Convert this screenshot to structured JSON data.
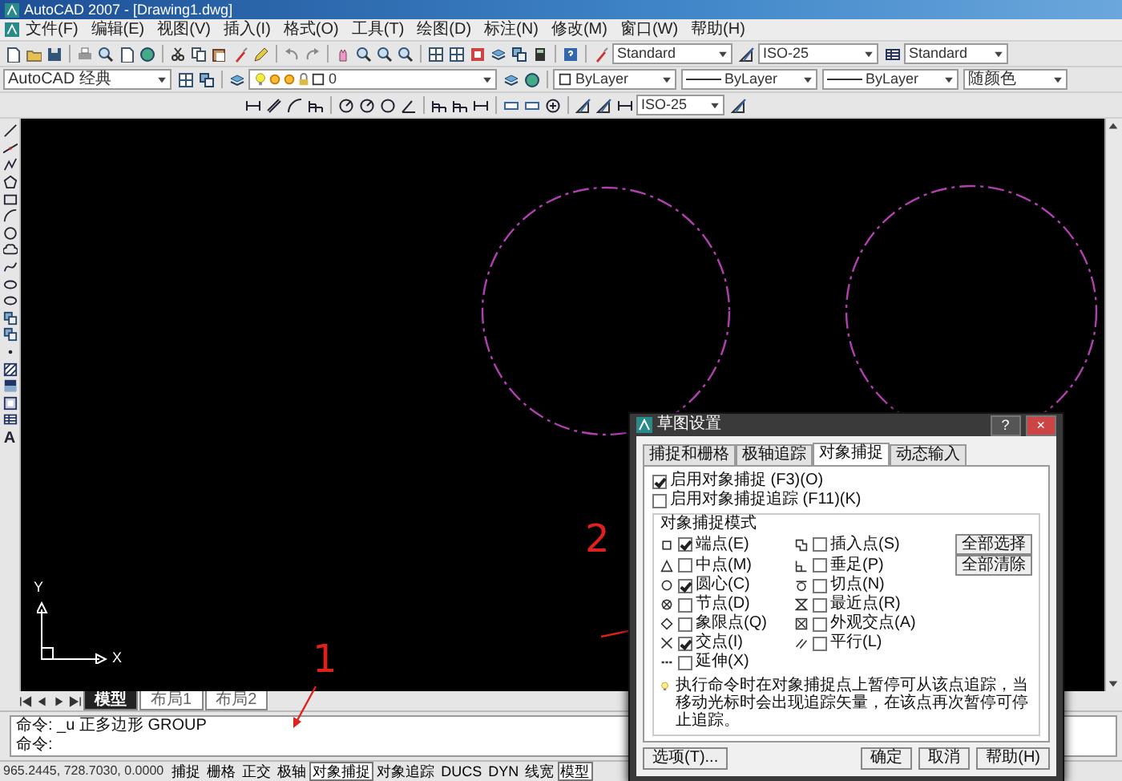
{
  "window": {
    "title": "AutoCAD 2007 - [Drawing1.dwg]"
  },
  "menu": [
    "文件(F)",
    "编辑(E)",
    "视图(V)",
    "插入(I)",
    "格式(O)",
    "工具(T)",
    "绘图(D)",
    "标注(N)",
    "修改(M)",
    "窗口(W)",
    "帮助(H)"
  ],
  "toolbar_1": {
    "text_style": "Standard",
    "dim_style": "ISO-25",
    "table_style": "Standard"
  },
  "toolbar_2": {
    "workspace": "AutoCAD 经典",
    "layer": "0",
    "color_control": "ByLayer",
    "linetype": "ByLayer",
    "lineweight": "ByLayer",
    "plot_style": "随颜色"
  },
  "toolbar_3": {
    "dim_style": "ISO-25"
  },
  "draw_toolbar": {
    "text_tool": "A"
  },
  "canvas": {
    "ucs": {
      "x_label": "X",
      "y_label": "Y"
    },
    "annotations": [
      "2",
      "1"
    ]
  },
  "layout_tabs": [
    {
      "label": "模型",
      "selected": true
    },
    {
      "label": "布局1",
      "selected": false
    },
    {
      "label": "布局2",
      "selected": false
    }
  ],
  "command_lines": [
    "命令: _u 正多边形 GROUP",
    "命令:"
  ],
  "status_bar": {
    "coordinates": "965.2445, 728.7030, 0.0000",
    "toggles": [
      {
        "label": "捕捉",
        "on": false
      },
      {
        "label": "栅格",
        "on": false
      },
      {
        "label": "正交",
        "on": false
      },
      {
        "label": "极轴",
        "on": false
      },
      {
        "label": "对象捕捉",
        "on": true
      },
      {
        "label": "对象追踪",
        "on": false
      },
      {
        "label": "DUCS",
        "on": false
      },
      {
        "label": "DYN",
        "on": false
      },
      {
        "label": "线宽",
        "on": false
      },
      {
        "label": "模型",
        "on": true
      }
    ]
  },
  "dialog": {
    "title": "草图设置",
    "title_buttons": [
      "?",
      "×"
    ],
    "tabs": [
      {
        "label": "捕捉和栅格",
        "selected": false
      },
      {
        "label": "极轴追踪",
        "selected": false
      },
      {
        "label": "对象捕捉",
        "selected": true
      },
      {
        "label": "动态输入",
        "selected": false
      }
    ],
    "enable_snap": {
      "label": "启用对象捕捉 (F3)(O)",
      "checked": true
    },
    "enable_tracking": {
      "label": "启用对象捕捉追踪 (F11)(K)",
      "checked": false
    },
    "group_title": "对象捕捉模式",
    "modes": [
      {
        "label": "端点(E)",
        "checked": true
      },
      {
        "label": "插入点(S)",
        "checked": false
      },
      {
        "label": "中点(M)",
        "checked": false
      },
      {
        "label": "垂足(P)",
        "checked": false
      },
      {
        "label": "圆心(C)",
        "checked": true
      },
      {
        "label": "切点(N)",
        "checked": false
      },
      {
        "label": "节点(D)",
        "checked": false
      },
      {
        "label": "最近点(R)",
        "checked": false
      },
      {
        "label": "象限点(Q)",
        "checked": false
      },
      {
        "label": "外观交点(A)",
        "checked": false
      },
      {
        "label": "交点(I)",
        "checked": true
      },
      {
        "label": "平行(L)",
        "checked": false
      },
      {
        "label": "延伸(X)",
        "checked": false
      }
    ],
    "side_buttons": [
      "全部选择",
      "全部清除"
    ],
    "hint": "执行命令时在对象捕捉点上暂停可从该点追踪，当移动光标时会出现追踪矢量，在该点再次暂停可停止追踪。",
    "buttons": [
      "选项(T)...",
      "确定",
      "取消",
      "帮助(H)"
    ]
  }
}
